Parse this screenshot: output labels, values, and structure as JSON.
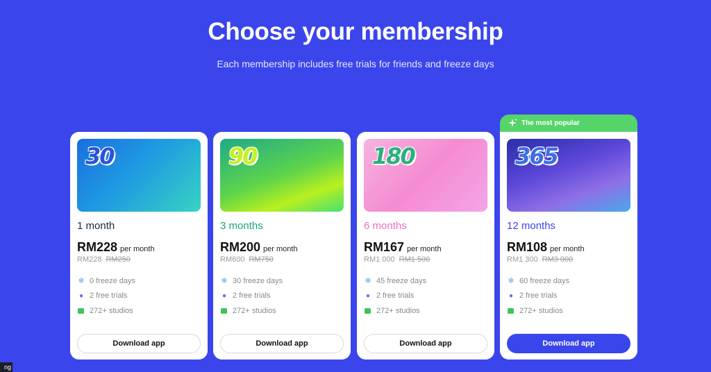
{
  "header": {
    "title": "Choose your membership",
    "subtitle": "Each membership includes free trials for friends and freeze days"
  },
  "colors": {
    "background": "#3a45ec",
    "popular_badge": "#55d46a",
    "duration_1": "#1b2a3a",
    "duration_2": "#1aa37e",
    "duration_3": "#ee6fc0",
    "duration_4": "#3a45ec"
  },
  "plans": [
    {
      "badge_number": "30",
      "duration": "1 month",
      "price": "RM228",
      "per": "per month",
      "total": "RM228",
      "old_total": "RM250",
      "features": [
        "0 freeze days",
        "2 free trials",
        "272+ studios"
      ],
      "button": "Download app"
    },
    {
      "badge_number": "90",
      "duration": "3 months",
      "price": "RM200",
      "per": "per month",
      "total": "RM600",
      "old_total": "RM750",
      "features": [
        "30 freeze days",
        "2 free trials",
        "272+ studios"
      ],
      "button": "Download app"
    },
    {
      "badge_number": "180",
      "duration": "6 months",
      "price": "RM167",
      "per": "per month",
      "total": "RM1 000",
      "old_total": "RM1 500",
      "features": [
        "45 freeze days",
        "2 free trials",
        "272+ studios"
      ],
      "button": "Download app"
    },
    {
      "badge_number": "365",
      "popular_label": "The most popular",
      "duration": "12 months",
      "price": "RM108",
      "per": "per month",
      "total": "RM1 300",
      "old_total": "RM3 000",
      "features": [
        "60 freeze days",
        "2 free trials",
        "272+ studios"
      ],
      "button": "Download app"
    }
  ],
  "corner_tag": "ng",
  "icons": {
    "freeze": "snowflake-icon",
    "trial": "person-icon",
    "studio": "studio-icon",
    "popular": "sparkle-icon"
  }
}
